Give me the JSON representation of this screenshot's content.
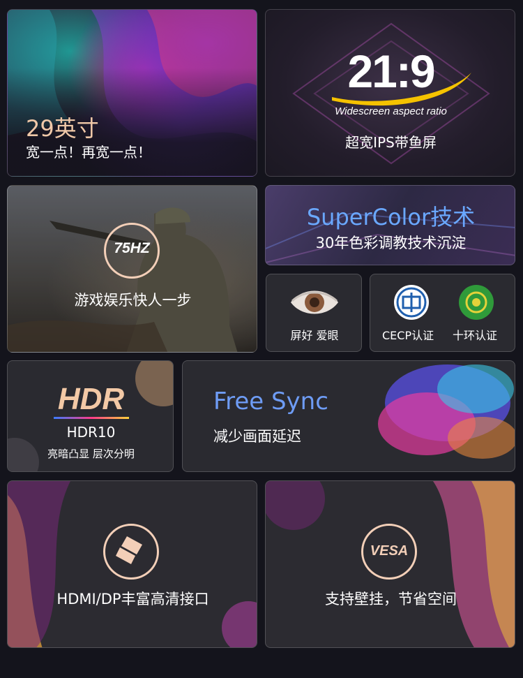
{
  "card_size": {
    "title": "29英寸",
    "subtitle": "宽一点！再宽一点！"
  },
  "card_ratio": {
    "ratio": "21:9",
    "caption": "Widescreen aspect ratio",
    "subtitle": "超宽IPS带鱼屏"
  },
  "card_refresh": {
    "badge": "75HZ",
    "subtitle": "游戏娱乐快人一步"
  },
  "card_color": {
    "title": "SuperColor技术",
    "subtitle": "30年色彩调教技术沉淀"
  },
  "card_eye": {
    "label": "屏好 爱眼"
  },
  "card_cert": {
    "label_1": "CECP认证",
    "label_2": "十环认证"
  },
  "card_hdr": {
    "logo": "HDR",
    "title": "HDR10",
    "subtitle": "亮暗凸显 层次分明"
  },
  "card_sync": {
    "title": "Free Sync",
    "subtitle": "减少画面延迟"
  },
  "card_ports": {
    "label": "HDMI/DP丰富高清接口"
  },
  "card_vesa": {
    "badge": "VESA",
    "label": "支持壁挂，节省空间"
  },
  "colors": {
    "accent_peach": "#f3cfb8",
    "super_blue": "#6aa8ff",
    "sync_blue": "#6e9cf5",
    "gold": "#f5c200"
  }
}
